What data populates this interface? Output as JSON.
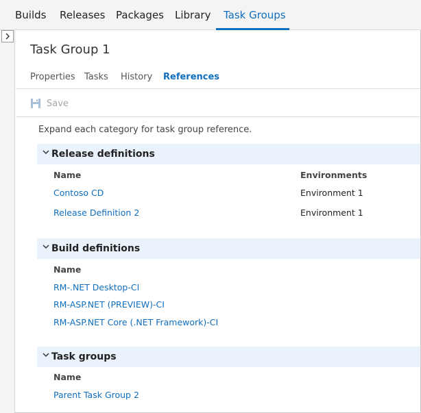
{
  "topnav": {
    "tabs": [
      {
        "label": "Builds"
      },
      {
        "label": "Releases"
      },
      {
        "label": "Packages"
      },
      {
        "label": "Library"
      },
      {
        "label": "Task Groups"
      }
    ],
    "active": "Task Groups",
    "accent_color": "#106ebe"
  },
  "sidebar": {
    "expand_icon": "chevron-right-icon"
  },
  "page": {
    "title": "Task Group 1",
    "subtabs": [
      {
        "label": "Properties"
      },
      {
        "label": "Tasks"
      },
      {
        "label": "History"
      },
      {
        "label": "References"
      }
    ],
    "active_subtab": "References"
  },
  "toolbar": {
    "save_label": "Save",
    "save_icon": "save-icon"
  },
  "intro": "Expand each category for task group reference.",
  "release_definitions": {
    "title": "Release definitions",
    "columns": [
      "Name",
      "Environments"
    ],
    "rows": [
      {
        "name": "Contoso CD",
        "environment": "Environment 1"
      },
      {
        "name": "Release Definition 2",
        "environment": "Environment 1"
      }
    ]
  },
  "build_definitions": {
    "title": "Build definitions",
    "columns": [
      "Name"
    ],
    "rows": [
      {
        "name": "RM-.NET Desktop-CI"
      },
      {
        "name": "RM-ASP.NET (PREVIEW)-CI"
      },
      {
        "name": "RM-ASP.NET Core (.NET Framework)-CI"
      }
    ]
  },
  "task_groups": {
    "title": "Task groups",
    "columns": [
      "Name"
    ],
    "rows": [
      {
        "name": "Parent Task Group 2"
      }
    ]
  },
  "colors": {
    "section_header_bg": "#eaf2fb",
    "link": "#106ebe",
    "disabled_text": "#a6a6a6"
  }
}
